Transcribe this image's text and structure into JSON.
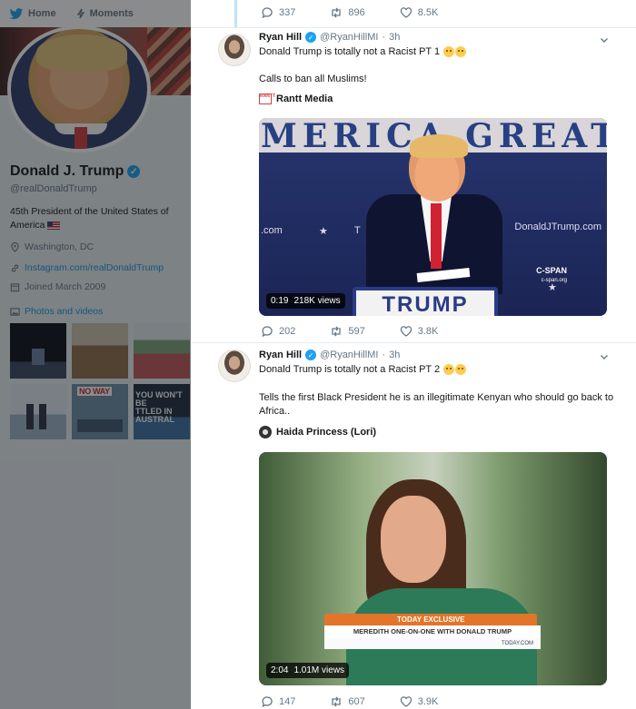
{
  "nav": {
    "home": "Home",
    "moments": "Moments"
  },
  "profile": {
    "name": "Donald J. Trump",
    "handle": "@realDonaldTrump",
    "bio": "45th President of the United States of America",
    "location": "Washington, DC",
    "website": "Instagram.com/realDonaldTrump",
    "joined": "Joined March 2009",
    "photos_label": "Photos and videos",
    "thumb_noway": "NO WAY",
    "thumb_wont": "YOU WON'T BE",
    "thumb_wont2": "TTLED IN AUSTRAL"
  },
  "top_actions": {
    "replies": "337",
    "retweets": "896",
    "likes": "8.5K"
  },
  "tweets": [
    {
      "name": "Ryan Hill",
      "handle": "@RyanHillMI",
      "time": "3h",
      "title": "Donald Trump is totally not a Racist PT 1",
      "body": "Calls to ban all Muslims!",
      "source": "Rantt Media",
      "source_logo": "RANTT",
      "video": {
        "duration": "0:19",
        "views": "218K views",
        "backdrop": "MERICA GREAT",
        "left_text": ".com",
        "right_text": "DonaldJTrump.com",
        "podium": "TRUMP",
        "network": "C-SPAN",
        "network_sub": "c-span.org"
      },
      "actions": {
        "replies": "202",
        "retweets": "597",
        "likes": "3.8K"
      }
    },
    {
      "name": "Ryan Hill",
      "handle": "@RyanHillMI",
      "time": "3h",
      "title": "Donald Trump is totally not a Racist PT 2",
      "body": "Tells the first Black President he is an illegitimate Kenyan who should go back to Africa..",
      "source": "Haida Princess (Lori)",
      "video": {
        "duration": "2:04",
        "views": "1.01M views",
        "banner_top": "TODAY EXCLUSIVE",
        "banner_main": "MEREDITH ONE-ON-ONE WITH DONALD TRUMP",
        "banner_sub": "TODAY.COM"
      },
      "actions": {
        "replies": "147",
        "retweets": "607",
        "likes": "3.9K"
      }
    }
  ]
}
